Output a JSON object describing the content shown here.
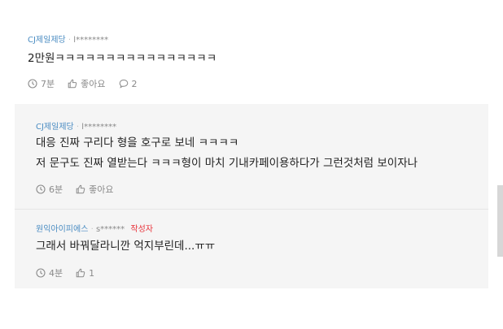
{
  "comments": [
    {
      "author": "CJ제일제당",
      "separator": "·",
      "user_id": "l********",
      "lines": [
        "2만원ㅋㅋㅋㅋㅋㅋㅋㅋㅋㅋㅋㅋㅋㅋㅋㅋ"
      ],
      "time": "7분",
      "like_label": "좋아요",
      "reply_count": "2"
    }
  ],
  "replies": [
    {
      "author": "CJ제일제당",
      "separator": "·",
      "user_id": "l********",
      "lines": [
        "대응 진짜 구리다 형을 호구로 보네 ㅋㅋㅋㅋ",
        "저 문구도 진짜 열받는다 ㅋㅋㅋ형이 마치 기내카페이용하다가 그런것처럼 보이자나"
      ],
      "time": "6분",
      "like_label": "좋아요"
    },
    {
      "author": "원익아이피에스",
      "separator": "·",
      "user_id": "s******",
      "badge": "작성자",
      "lines": [
        "그래서 바꿔달라니깐 억지부린데...ㅠㅠ"
      ],
      "time": "4분",
      "like_label": "1"
    }
  ],
  "colors": {
    "nickname": "#4a8cc2",
    "author_badge": "#e8343c",
    "reply_background": "#f5f5f5",
    "muted": "#8a8a8a"
  }
}
